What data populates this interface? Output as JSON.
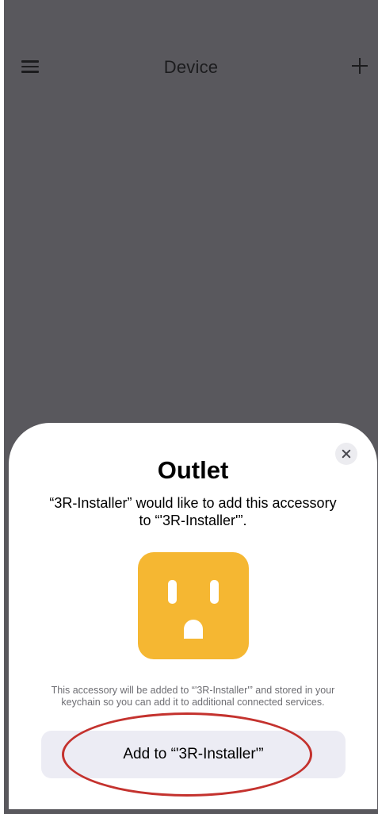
{
  "nav": {
    "title": "Device",
    "menu_icon": "menu-icon",
    "add_icon": "plus-icon"
  },
  "sheet": {
    "title": "Outlet",
    "message": "“3R-Installer” would like to add this accessory to “'3R-Installer'”.",
    "accessory_icon": "outlet-icon",
    "close_icon": "close-icon",
    "info": "This accessory will be added to “'3R-Installer'” and stored in your keychain so you can add it to additional connected services.",
    "add_button_label": "Add to “'3R-Installer'”"
  },
  "colors": {
    "backdrop": "#59585d",
    "sheet": "#ffffff",
    "accessory_tile": "#f5b732",
    "button": "#ececf4",
    "highlight": "#c4322e"
  }
}
